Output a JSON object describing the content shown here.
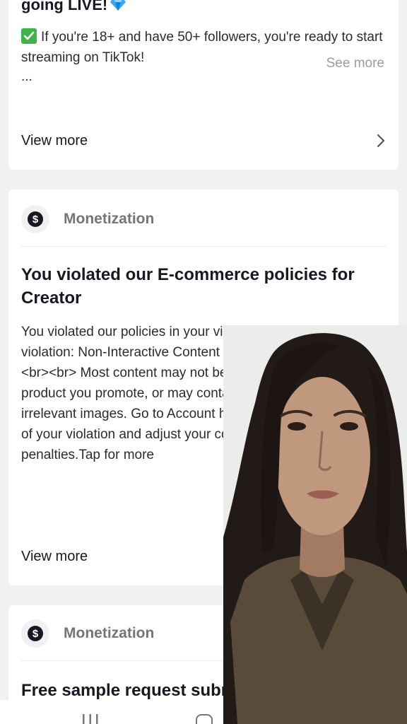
{
  "card1": {
    "title": "going LIVE!",
    "body": "If you're 18+ and have 50+ followers, you're ready to start streaming on TikTok!",
    "ellipsis": "...",
    "see_more": "See more",
    "view_more": "View more"
  },
  "card2": {
    "category": "Monetization",
    "title": "You violated our E-commerce policies for Creator",
    "body": "You violated our policies in your video. The reason of your violation: Non-Interactive Content Product Promotion (Video)<br><br> Most content may not be clearly related to the product you promote, or may contain too much text, static or irrelevant images. Go to Account health to can see the detail of your violation and adjust your content to avoid penalties.Tap for more",
    "view_more": "View more"
  },
  "card3": {
    "category": "Monetization",
    "title": "Free sample request submitted"
  },
  "colors": {
    "background": "#f1f1f2",
    "card": "#ffffff",
    "text_primary": "#161823",
    "text_secondary": "#74757b",
    "see_more": "#9b9ca1",
    "check_green": "#3fb24a"
  },
  "icons": [
    "gem-icon",
    "check-icon",
    "dollar-icon",
    "chevron-right-icon",
    "recents-icon",
    "home-icon"
  ]
}
